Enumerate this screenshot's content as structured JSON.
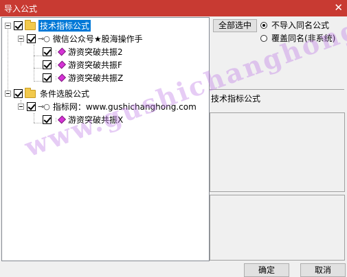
{
  "window": {
    "title": "导入公式",
    "close_glyph": "✕"
  },
  "tree": {
    "groups": [
      {
        "label": "技术指标公式",
        "children": [
          {
            "label": "微信公众号★股海操作手",
            "items": [
              "游资突破共振2",
              "游资突破共振F",
              "游资突破共振Z"
            ]
          }
        ]
      },
      {
        "label": "条件选股公式",
        "children": [
          {
            "label": "指标网：www.gushichanghong.com",
            "items": [
              "游资突破共振X"
            ]
          }
        ]
      }
    ]
  },
  "right": {
    "select_all_button": "全部选中",
    "radio_no_import": "不导入同名公式",
    "radio_overwrite": "覆盖同名(非系统)",
    "section_label": "技术指标公式"
  },
  "footer": {
    "ok_button": "确定",
    "cancel_button": "取消"
  },
  "watermark": "www.gushichanghong.com",
  "colors": {
    "titlebar": "#c83a32",
    "selection": "#0078d7",
    "item_icon": "#d633d6",
    "folder": "#f2c94c"
  }
}
